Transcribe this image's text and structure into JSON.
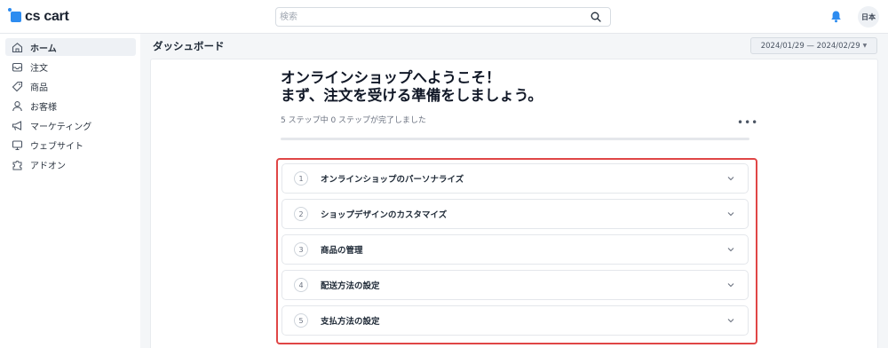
{
  "brand": {
    "name": "cs cart",
    "accent": "#2d8cf0"
  },
  "search": {
    "placeholder": "検索"
  },
  "user": {
    "language_badge": "日本"
  },
  "sidebar": {
    "items": [
      {
        "label": "ホーム",
        "icon": "home-icon",
        "active": true
      },
      {
        "label": "注文",
        "icon": "inbox-icon"
      },
      {
        "label": "商品",
        "icon": "tag-icon"
      },
      {
        "label": "お客様",
        "icon": "user-icon"
      },
      {
        "label": "マーケティング",
        "icon": "megaphone-icon"
      },
      {
        "label": "ウェブサイト",
        "icon": "monitor-icon"
      },
      {
        "label": "アドオン",
        "icon": "puzzle-icon"
      }
    ]
  },
  "header": {
    "title": "ダッシュボード",
    "date_range": "2024/01/29 — 2024/02/29"
  },
  "onboarding": {
    "title_line1": "オンラインショップへようこそ！",
    "title_line2": "まず、注文を受ける準備をしましょう。",
    "progress_text": "5 ステップ中 0 ステップが完了しました",
    "progress_fraction": 0,
    "steps": [
      {
        "number": "1",
        "label": "オンラインショップのパーソナライズ"
      },
      {
        "number": "2",
        "label": "ショップデザインのカスタマイズ"
      },
      {
        "number": "3",
        "label": "商品の管理"
      },
      {
        "number": "4",
        "label": "配送方法の設定"
      },
      {
        "number": "5",
        "label": "支払方法の設定"
      }
    ]
  },
  "colors": {
    "highlight_border": "#e04646",
    "bell": "#2d8cf0"
  }
}
